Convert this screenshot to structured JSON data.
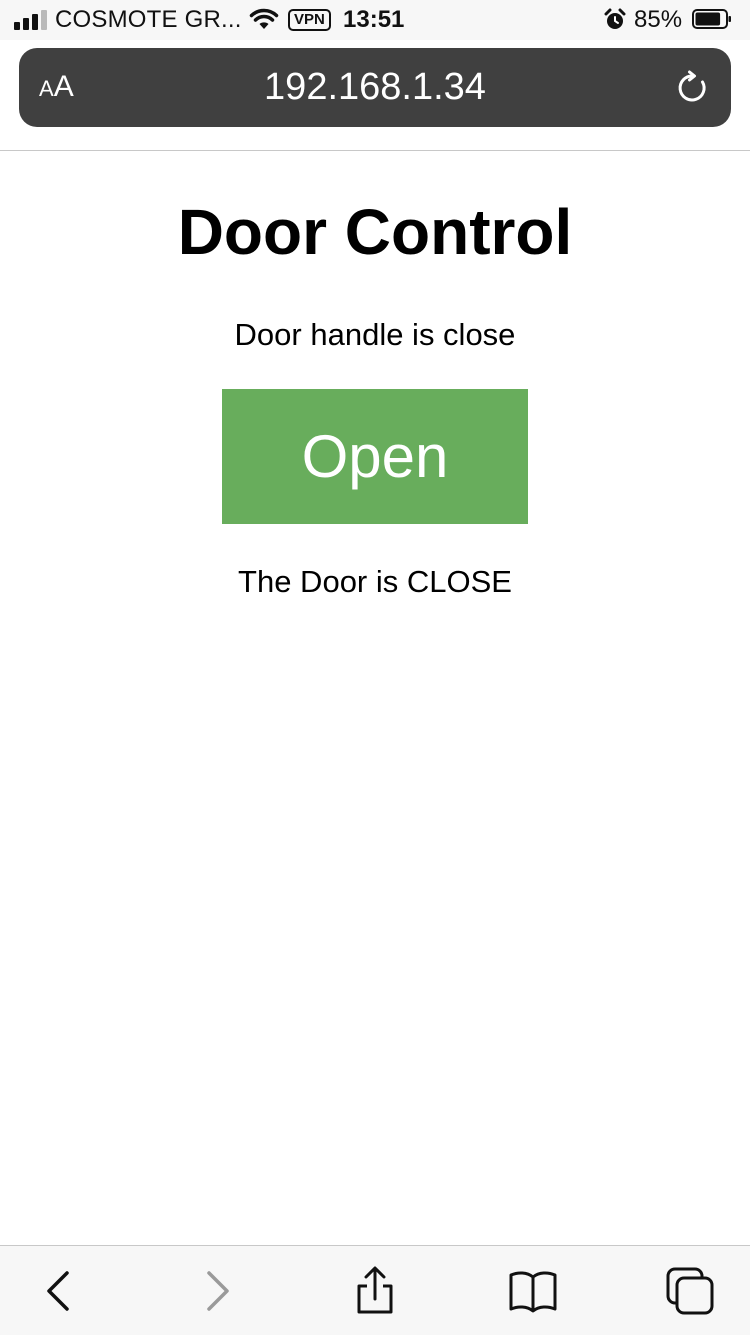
{
  "status_bar": {
    "carrier": "COSMOTE GR...",
    "vpn": "VPN",
    "time": "13:51",
    "battery": "85%",
    "battery_level": 0.85,
    "icons": [
      "signal-icon",
      "wifi-icon",
      "alarm-icon",
      "battery-icon"
    ]
  },
  "browser": {
    "text_size_button": "AA",
    "address": "192.168.1.34",
    "icons": [
      "reload-icon"
    ]
  },
  "page": {
    "title": "Door Control",
    "handle_status": "Door handle is close",
    "open_button": "Open",
    "door_status": "The Door is CLOSE",
    "button_color": "#68ad5c"
  },
  "toolbar": {
    "icons": [
      "back-icon",
      "forward-icon",
      "share-icon",
      "bookmarks-icon",
      "tabs-icon"
    ]
  }
}
